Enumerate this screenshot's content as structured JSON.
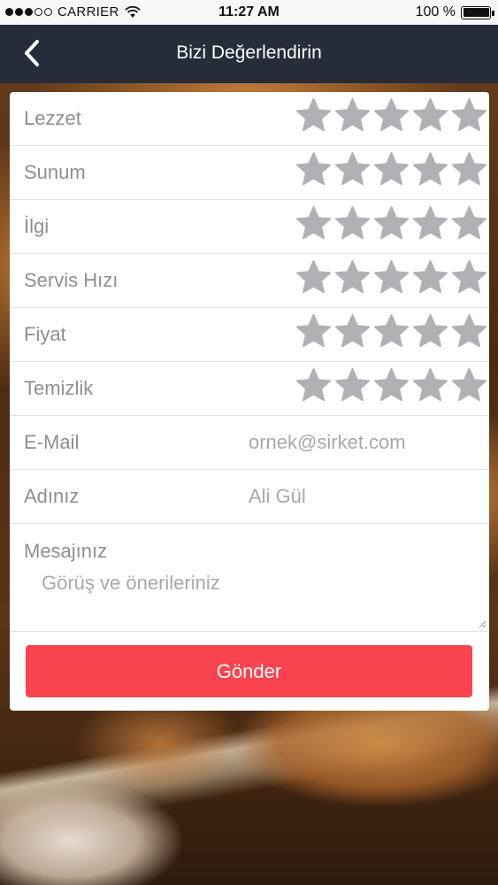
{
  "status_bar": {
    "carrier": "CARRIER",
    "time": "11:27 AM",
    "battery": "100 %",
    "signal_bars_filled": 3,
    "signal_bars_total": 5
  },
  "nav": {
    "title": "Bizi Değerlendirin",
    "back_icon": "chevron-left-icon"
  },
  "ratings": [
    {
      "label": "Lezzet",
      "stars_max": 5,
      "stars_selected": 0
    },
    {
      "label": "Sunum",
      "stars_max": 5,
      "stars_selected": 0
    },
    {
      "label": "İlgi",
      "stars_max": 5,
      "stars_selected": 0
    },
    {
      "label": "Servis Hızı",
      "stars_max": 5,
      "stars_selected": 0
    },
    {
      "label": "Fiyat",
      "stars_max": 5,
      "stars_selected": 0
    },
    {
      "label": "Temizlik",
      "stars_max": 5,
      "stars_selected": 0
    }
  ],
  "form": {
    "email_label": "E-Mail",
    "email_placeholder": "ornek@sirket.com",
    "name_label": "Adınız",
    "name_placeholder": "Ali Gül",
    "message_label": "Mesajınız",
    "message_placeholder": "Görüş ve önerileriniz",
    "submit_label": "Gönder"
  },
  "colors": {
    "nav_background": "#262c3a",
    "submit_background": "#f9444f",
    "star_empty": "#b1b1b5",
    "label_text": "#8e8e93"
  }
}
